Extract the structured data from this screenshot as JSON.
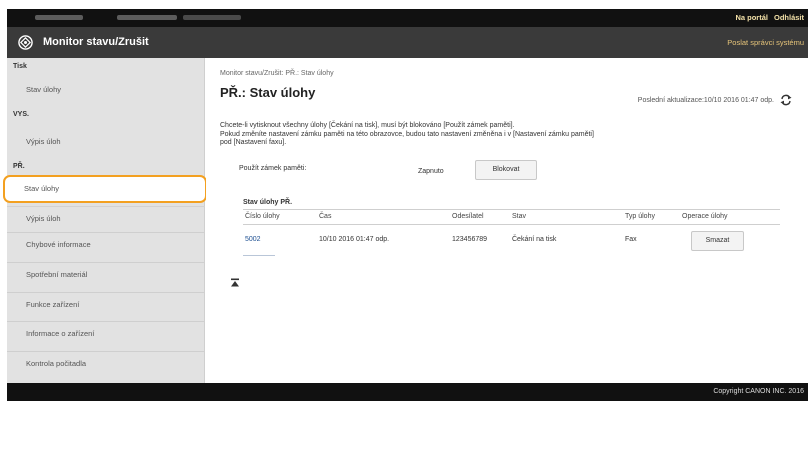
{
  "topbar": {
    "portal_link": "Na portál",
    "logout_link": "Odhlásit"
  },
  "header": {
    "title": "Monitor stavu/Zrušit",
    "sysadmin_link": "Poslat správci systému",
    "logo_icon": "canon-logo-icon"
  },
  "sidebar": {
    "sections": [
      {
        "heading": "Tisk",
        "items": [
          {
            "label": "Stav úlohy"
          }
        ]
      },
      {
        "heading": "VYS.",
        "items": [
          {
            "label": "Výpis úloh"
          }
        ]
      },
      {
        "heading": "PŘ.",
        "items": [
          {
            "label": "Stav úlohy"
          },
          {
            "label": "Výpis úloh"
          }
        ]
      }
    ],
    "main_items": [
      {
        "label": "Chybové informace"
      },
      {
        "label": "Spotřební materiál"
      },
      {
        "label": "Funkce zařízení"
      },
      {
        "label": "Informace o zařízení"
      },
      {
        "label": "Kontrola počitadla"
      }
    ],
    "selected": "PŘ. / Stav úlohy"
  },
  "main": {
    "breadcrumb": "Monitor stavu/Zrušit: PŘ.: Stav úlohy",
    "title": "PŘ.: Stav úlohy",
    "last_update": "Poslední aktualizace:10/10 2016 01:47 odp.",
    "refresh_icon": "refresh-icon",
    "description_line1": "Chcete-li vytisknout všechny úlohy [Čekání na tisk], musí být blokováno [Použít zámek paměti].",
    "description_line2": "Pokud změníte nastavení zámku paměti na této obrazovce, budou tato nastavení změněna i v [Nastavení zámku paměti]",
    "description_line3": "pod [Nastavení faxu].",
    "memory_lock_label": "Použít zámek paměti:",
    "memory_lock_value": "Zapnuto",
    "block_button": "Blokovat",
    "table": {
      "title": "Stav úlohy PŘ.",
      "columns": [
        "Číslo úlohy",
        "Čas",
        "Odesílatel",
        "Stav",
        "Typ úlohy",
        "Operace úlohy"
      ],
      "rows": [
        {
          "job_no": "5002",
          "time": "10/10 2016 01:47 odp.",
          "sender": "123456789",
          "status": "Čekání na tisk",
          "type": "Fax",
          "action": "Smazat"
        }
      ]
    },
    "to_top_icon": "to-top-icon"
  },
  "footer": {
    "copyright": "Copyright CANON INC. 2016"
  },
  "colors": {
    "highlight": "#f3a020",
    "link": "#1d4f91",
    "topbar": "#111111",
    "titlebar": "#3a3a3a",
    "sidebar": "#e2e2e2"
  }
}
